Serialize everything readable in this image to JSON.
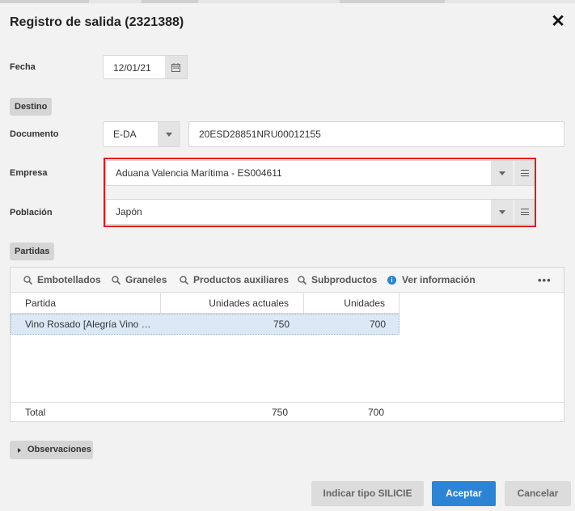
{
  "dialog": {
    "title": "Registro de salida (2321388)"
  },
  "form": {
    "fecha_label": "Fecha",
    "fecha_value": "12/01/21",
    "destino_chip": "Destino",
    "documento_label": "Documento",
    "documento_type": "E-DA",
    "documento_number": "20ESD28851NRU00012155",
    "empresa_label": "Empresa",
    "empresa_value": "Aduana Valencia Marítima - ES004611",
    "poblacion_label": "Población",
    "poblacion_value": "Japón"
  },
  "partidas": {
    "chip": "Partidas",
    "toolbar": [
      {
        "label": "Embotellados",
        "icon": "search-icon"
      },
      {
        "label": "Graneles",
        "icon": "search-icon"
      },
      {
        "label": "Productos auxiliares",
        "icon": "search-icon"
      },
      {
        "label": "Subproductos",
        "icon": "search-icon"
      },
      {
        "label": "Ver información",
        "icon": "info-icon"
      }
    ],
    "more": "•••",
    "columns": [
      "Partida",
      "Unidades actuales",
      "Unidades"
    ],
    "rows": [
      {
        "partida": "Vino Rosado [Alegría Vino …",
        "unidades_actuales": "750",
        "unidades": "700"
      }
    ],
    "total": {
      "label": "Total",
      "unidades_actuales": "750",
      "unidades": "700"
    }
  },
  "observaciones": {
    "label": "Observaciones"
  },
  "buttons": {
    "silicie": "Indicar tipo SILICIE",
    "aceptar": "Aceptar",
    "cancelar": "Cancelar"
  },
  "colors": {
    "accent": "#2e84d4",
    "highlight_border": "#e01b1b",
    "selected_row": "#dce8f6",
    "background": "#f2f2f2"
  }
}
